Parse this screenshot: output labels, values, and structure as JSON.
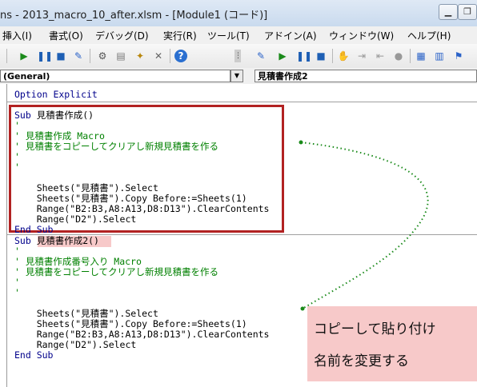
{
  "window": {
    "title": "ns - 2013_macro_10_after.xlsm - [Module1 (コード)]",
    "buttons": [
      "minimize-icon",
      "restore-icon"
    ]
  },
  "menu": {
    "items": [
      "挿入(I)",
      "書式(O)",
      "デバッグ(D)",
      "実行(R)",
      "ツール(T)",
      "アドイン(A)",
      "ウィンドウ(W)",
      "ヘルプ(H)"
    ]
  },
  "toolbar": {
    "icons": [
      "run-icon",
      "pause-icon",
      "stop-icon",
      "design-mode-icon",
      "project-explorer-icon",
      "properties-icon",
      "object-browser-icon",
      "toolbox-icon",
      "help-icon",
      "design-mode-icon",
      "run-icon",
      "pause-icon",
      "stop-icon",
      "hand-icon",
      "indent-icon",
      "outdent-icon",
      "breakpoint-icon",
      "comment-icon",
      "uncomment-icon",
      "bookmark-icon"
    ]
  },
  "combos": {
    "object": "(General)",
    "procedure": "見積書作成2"
  },
  "code": {
    "option": "Option Explicit",
    "sub1_header": "Sub 見積書作成()",
    "quote1": "'",
    "sub1_comment1": "' 見積書作成 Macro",
    "sub1_comment2": "' 見積書をコピーしてクリアし新規見積書を作る",
    "quote2": "'",
    "quote3": "'",
    "sub1_line1": "    Sheets(\"見積書\").Select",
    "sub1_line2": "    Sheets(\"見積書\").Copy Before:=Sheets(1)",
    "sub1_line3": "    Range(\"B2:B3,A8:A13,D8:D13\").ClearContents",
    "sub1_line4": "    Range(\"D2\").Select",
    "sub1_end": "End Sub",
    "sub2_header": "Sub 見積書作成2()",
    "quote4": "'",
    "sub2_comment1": "' 見積書作成番号入り Macro",
    "sub2_comment2": "' 見積書をコピーしてクリアし新規見積書を作る",
    "quote5": "'",
    "quote6": "'",
    "sub2_line1": "    Sheets(\"見積書\").Select",
    "sub2_line2": "    Sheets(\"見積書\").Copy Before:=Sheets(1)",
    "sub2_line3": "    Range(\"B2:B3,A8:A13,D8:D13\").ClearContents",
    "sub2_line4": "    Range(\"D2\").Select",
    "sub2_end": "End Sub"
  },
  "callout": {
    "line1": "コピーして貼り付け",
    "line2": "名前を変更する"
  },
  "colors": {
    "keyword": "#00008b",
    "comment": "#008000",
    "highlight_border": "#b22222",
    "callout_bg": "#f7c9c9",
    "arrow": "#1a8a1a"
  }
}
